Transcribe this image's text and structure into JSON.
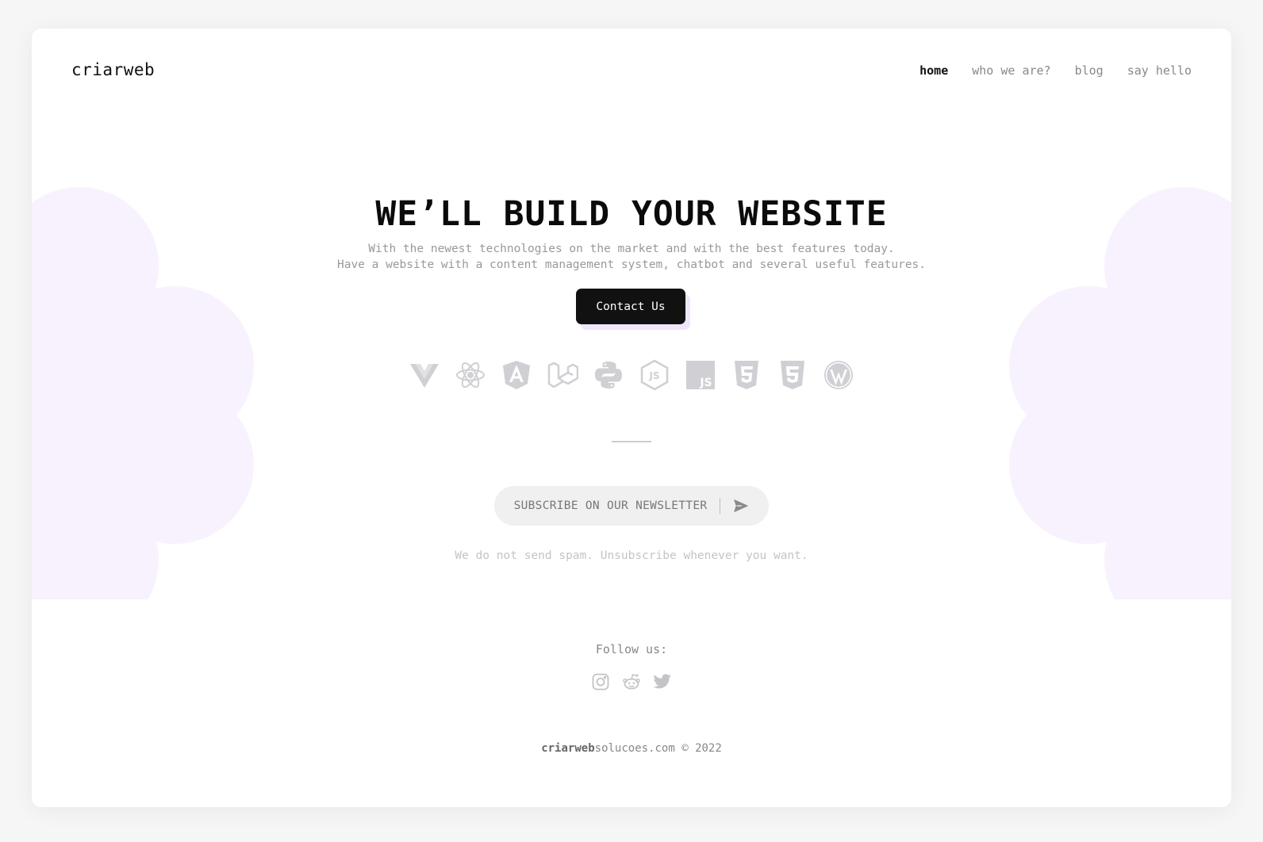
{
  "header": {
    "logo": "criarweb",
    "nav": [
      {
        "label": "home",
        "active": true
      },
      {
        "label": "who we are?",
        "active": false
      },
      {
        "label": "blog",
        "active": false
      },
      {
        "label": "say hello",
        "active": false
      }
    ]
  },
  "hero": {
    "title": "WE’LL BUILD YOUR WEBSITE",
    "subtitle_line1": "With the newest technologies on the market and with the best features today.",
    "subtitle_line2": "Have a website with a content management system, chatbot and several useful features.",
    "cta_label": "Contact Us",
    "technologies": [
      "vue-icon",
      "react-icon",
      "angular-icon",
      "laravel-icon",
      "python-icon",
      "nodejs-icon",
      "javascript-icon",
      "html5-icon",
      "css3-icon",
      "wordpress-icon"
    ]
  },
  "newsletter": {
    "label": "SUBSCRIBE ON OUR NEWSLETTER",
    "note": "We do not send spam. Unsubscribe whenever you want."
  },
  "follow": {
    "label": "Follow us:",
    "icons": [
      "instagram-icon",
      "reddit-icon",
      "twitter-icon"
    ]
  },
  "footer": {
    "brand": "criarweb",
    "rest": "solucoes.com © 2022"
  },
  "colors": {
    "accent_blob": "#f7f2fd",
    "icon_gray": "#cfcfd4",
    "button_bg": "#111111"
  }
}
